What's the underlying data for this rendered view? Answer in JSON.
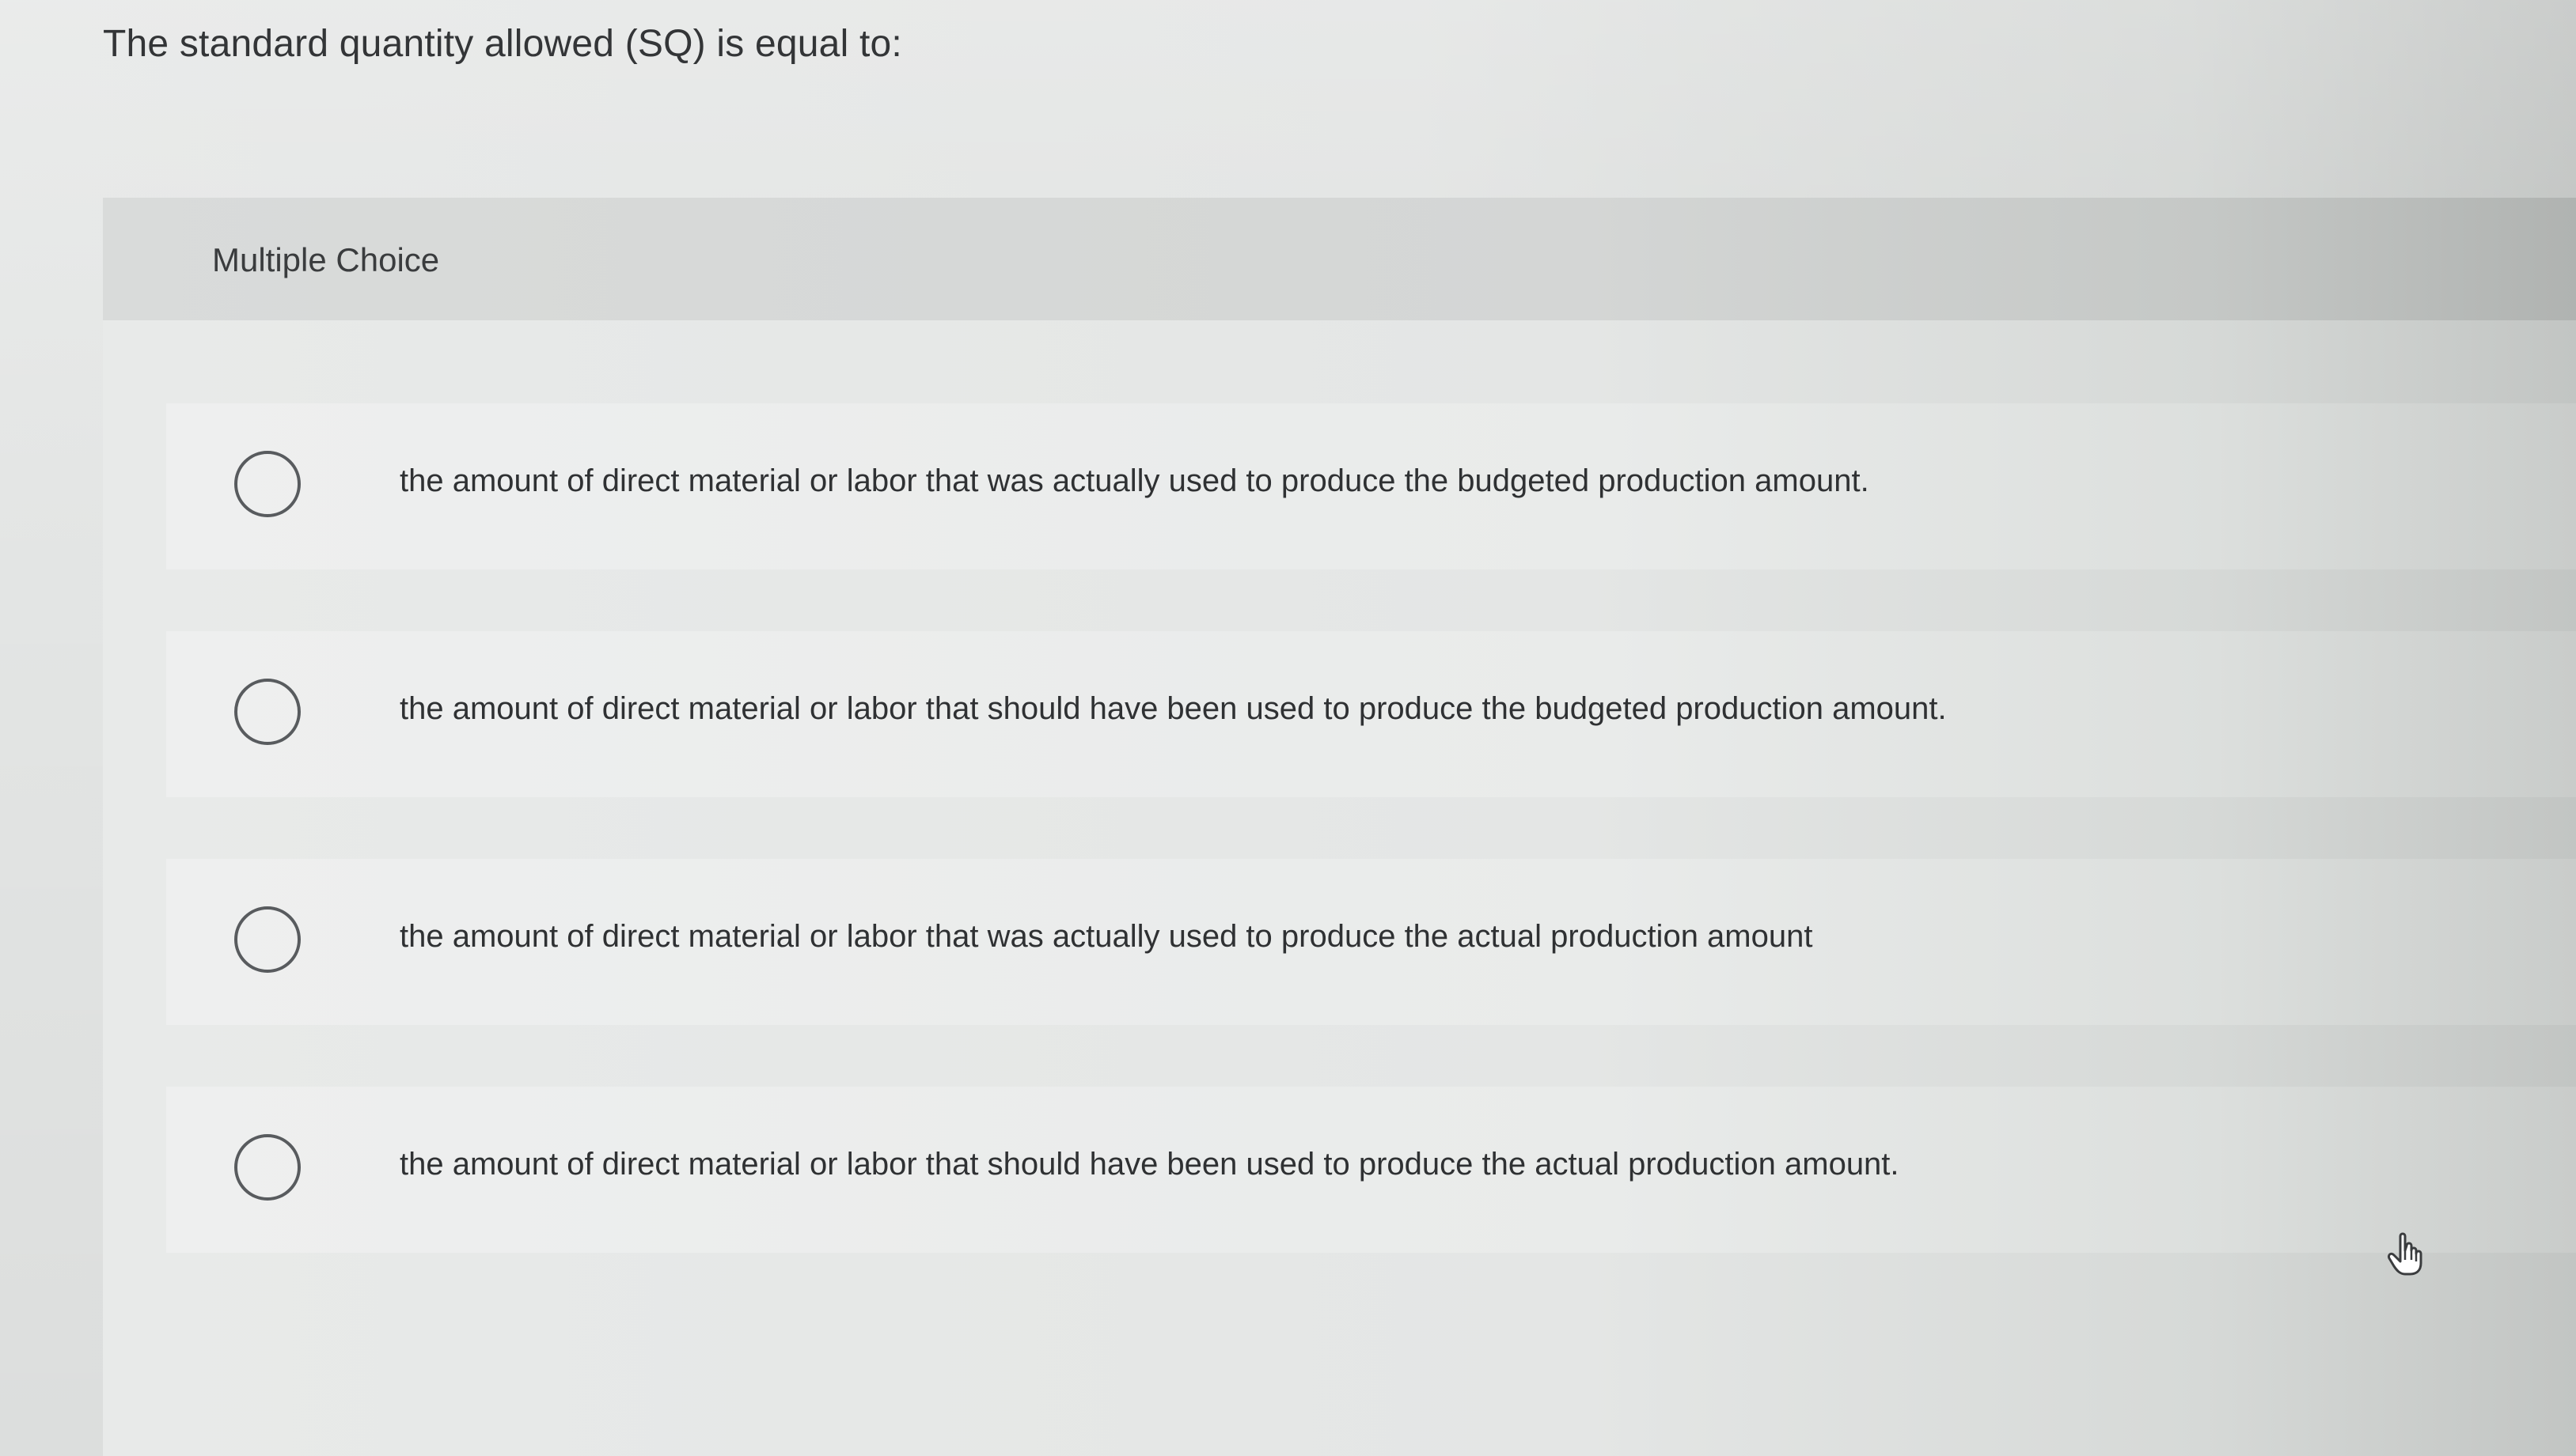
{
  "question": {
    "text": "The standard quantity allowed (SQ) is equal to:"
  },
  "panel": {
    "type_label": "Multiple Choice"
  },
  "options": [
    {
      "label": "the amount of direct material or labor that was actually used to produce the budgeted production amount."
    },
    {
      "label": "the amount of direct material or labor that should have been used to produce the budgeted production amount."
    },
    {
      "label": "the amount of direct material or labor that was actually used to produce the actual production amount"
    },
    {
      "label": "the amount of direct material or labor that should have been used to produce the actual production amount."
    }
  ],
  "icons": {
    "radio": "radio-button-unselected-icon",
    "cursor": "hand-pointer-icon"
  },
  "colors": {
    "text": "#2d2f31",
    "radio_border": "#585b5e",
    "background": "#e3e5e4"
  }
}
